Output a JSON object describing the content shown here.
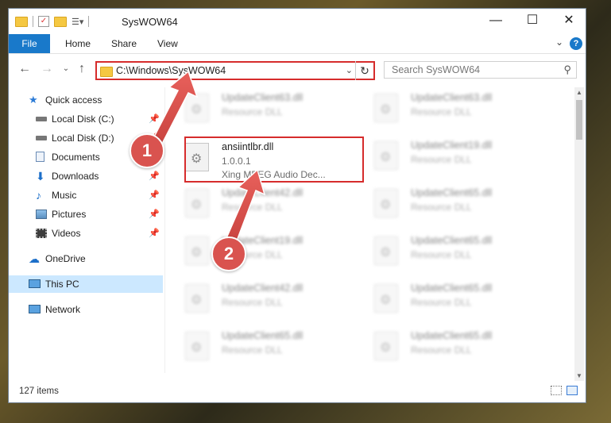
{
  "window": {
    "title": "SysWOW64"
  },
  "controls": {
    "minimize": "—",
    "maximize": "☐",
    "close": "✕"
  },
  "ribbon": {
    "tabs": [
      "File",
      "Home",
      "Share",
      "View"
    ],
    "help": "?"
  },
  "nav": {
    "address": "C:\\Windows\\SysWOW64",
    "search_placeholder": "Search SysWOW64"
  },
  "sidebar": {
    "items": [
      {
        "label": "Quick access",
        "icon": "star-icon",
        "pinned": false
      },
      {
        "label": "Local Disk (C:)",
        "icon": "drive-icon",
        "pinned": true
      },
      {
        "label": "Local Disk (D:)",
        "icon": "drive-icon",
        "pinned": true
      },
      {
        "label": "Documents",
        "icon": "document-icon",
        "pinned": true
      },
      {
        "label": "Downloads",
        "icon": "download-icon",
        "pinned": true
      },
      {
        "label": "Music",
        "icon": "music-icon",
        "pinned": true
      },
      {
        "label": "Pictures",
        "icon": "pictures-icon",
        "pinned": true
      },
      {
        "label": "Videos",
        "icon": "video-icon",
        "pinned": true
      },
      {
        "label": "OneDrive",
        "icon": "cloud-icon",
        "pinned": false
      },
      {
        "label": "This PC",
        "icon": "computer-icon",
        "pinned": false,
        "selected": true
      },
      {
        "label": "Network",
        "icon": "network-icon",
        "pinned": false
      }
    ]
  },
  "files": {
    "highlighted": {
      "name": "ansiintlbr.dll",
      "version": "1.0.0.1",
      "description": "Xing MPEG Audio Dec..."
    },
    "left_col": [
      {
        "name": "UpdateClient63.dll",
        "type": "Resource DLL"
      },
      {
        "name": "UpdateClient42.dll",
        "type": "Resource DLL"
      },
      {
        "name": "UpdateClient19.dll",
        "type": "Resource DLL"
      },
      {
        "name": "UpdateClient42.dll",
        "type": "Resource DLL"
      },
      {
        "name": "UpdateClient65.dll",
        "type": "Resource DLL"
      }
    ],
    "right_col": [
      {
        "name": "UpdateClient63.dll",
        "type": "Resource DLL"
      },
      {
        "name": "UpdateClient19.dll",
        "type": "Resource DLL"
      },
      {
        "name": "UpdateClient65.dll",
        "type": "Resource DLL"
      },
      {
        "name": "UpdateClient65.dll",
        "type": "Resource DLL"
      },
      {
        "name": "UpdateClient65.dll",
        "type": "Resource DLL"
      },
      {
        "name": "UpdateClient65.dll",
        "type": "Resource DLL"
      }
    ]
  },
  "status": {
    "count": "127 items"
  },
  "annotations": {
    "step1": "1",
    "step2": "2",
    "color": "#d9534f"
  }
}
